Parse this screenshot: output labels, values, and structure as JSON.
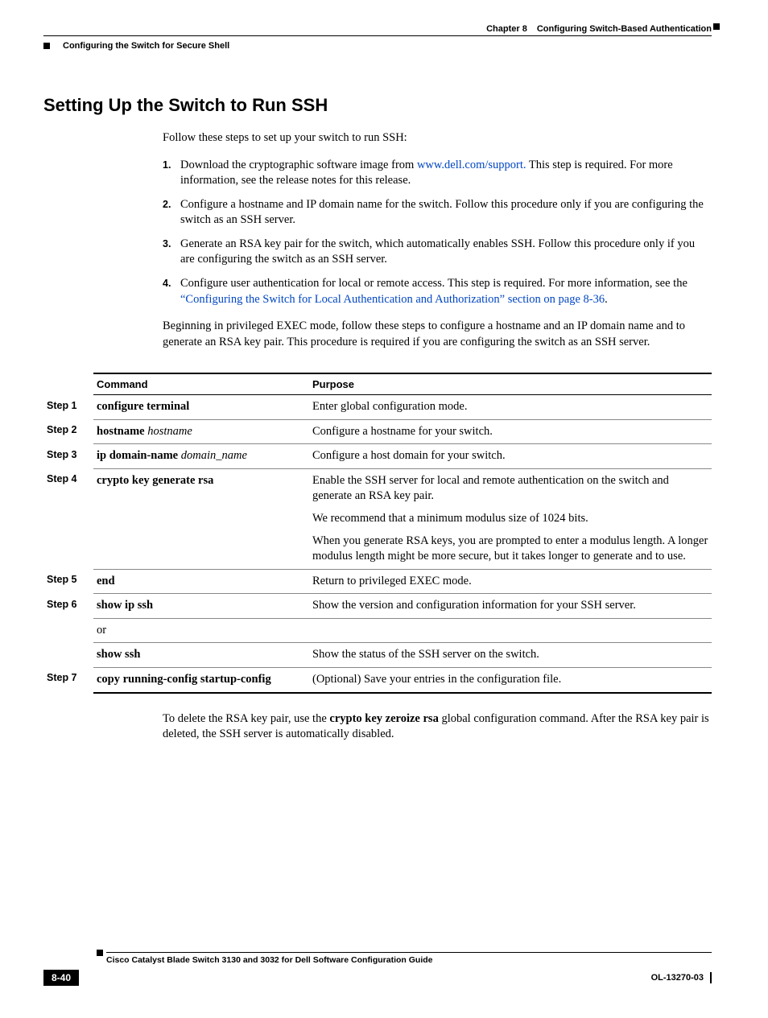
{
  "header": {
    "chapter": "Chapter 8",
    "chapter_title": "Configuring Switch-Based Authentication",
    "running_head": "Configuring the Switch for Secure Shell"
  },
  "section_title": "Setting Up the Switch to Run SSH",
  "intro": "Follow these steps to set up your switch to run SSH:",
  "steps_list": [
    {
      "n": "1.",
      "before_link": " Download the cryptographic software image from ",
      "link": "www.dell.com/support.",
      "after_link": " This step is required. For more information, see the release notes for this release."
    },
    {
      "n": "2.",
      "text": "Configure a hostname and IP domain name for the switch. Follow this procedure only if you are configuring the switch as an SSH server."
    },
    {
      "n": "3.",
      "text": "Generate an RSA key pair for the switch, which automatically enables SSH. Follow this procedure only if you are configuring the switch as an SSH server."
    },
    {
      "n": "4.",
      "before_link": "Configure user authentication for local or remote access. This step is required. For more information, see the ",
      "link": "“Configuring the Switch for Local Authentication and Authorization” section on page 8-36",
      "after_link": "."
    }
  ],
  "paragraph2": "Beginning in privileged EXEC mode, follow these steps to configure a hostname and an IP domain name and to generate an RSA key pair. This procedure is required if you are configuring the switch as an SSH server.",
  "table": {
    "headers": {
      "command": "Command",
      "purpose": "Purpose"
    },
    "rows": [
      {
        "step": "Step 1",
        "cmd_bold": "configure terminal",
        "purpose": [
          "Enter global configuration mode."
        ]
      },
      {
        "step": "Step 2",
        "cmd_bold": "hostname",
        "cmd_ital": " hostname",
        "purpose": [
          "Configure a hostname for your switch."
        ]
      },
      {
        "step": "Step 3",
        "cmd_bold": "ip domain-name",
        "cmd_ital": " domain_name",
        "purpose": [
          "Configure a host domain for your switch."
        ]
      },
      {
        "step": "Step 4",
        "cmd_bold": "crypto key generate rsa",
        "purpose": [
          "Enable the SSH server for local and remote authentication on the switch and generate an RSA key pair.",
          "We recommend that a minimum modulus size of 1024 bits.",
          "When you generate RSA keys, you are prompted to enter a modulus length. A longer modulus length might be more secure, but it takes longer to generate and to use."
        ]
      },
      {
        "step": "Step 5",
        "cmd_bold": "end",
        "purpose": [
          "Return to privileged EXEC mode."
        ]
      },
      {
        "step": "Step 6",
        "cmd_bold": "show ip ssh",
        "purpose": [
          "Show the version and configuration information for your SSH server."
        ],
        "extra": {
          "or": "or",
          "cmd2_bold": "show ssh",
          "purpose2": "Show the status of the SSH server on the switch."
        }
      },
      {
        "step": "Step 7",
        "cmd_bold": "copy running-config startup-config",
        "purpose": [
          "(Optional) Save your entries in the configuration file."
        ]
      }
    ]
  },
  "closing": {
    "pre": "To delete the RSA key pair, use the ",
    "bold": "crypto key zeroize rsa",
    "post": " global configuration command. After the RSA key pair is deleted, the SSH server is automatically disabled."
  },
  "footer": {
    "guide": "Cisco Catalyst Blade Switch 3130 and 3032 for Dell Software Configuration Guide",
    "page": "8-40",
    "docid": "OL-13270-03"
  }
}
